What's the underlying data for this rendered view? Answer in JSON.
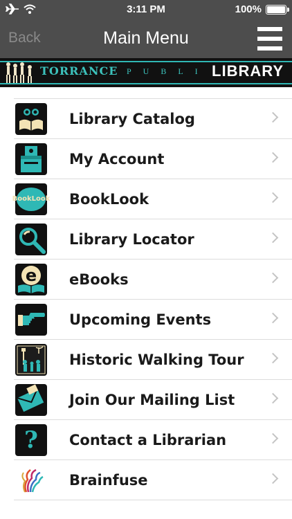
{
  "status_bar": {
    "time": "3:11 PM",
    "battery": "100%"
  },
  "nav": {
    "back_label": "Back",
    "title": "Main Menu"
  },
  "banner": {
    "name": "TORRANCE",
    "public": "PUBLIC",
    "library": "LIBRARY",
    "accent_color": "#2fb8b5"
  },
  "menu": {
    "items": [
      {
        "label": "Library Catalog",
        "icon": "catalog-icon"
      },
      {
        "label": "My Account",
        "icon": "account-icon"
      },
      {
        "label": "BookLook",
        "icon": "booklook-icon",
        "icon_text": "BookLook"
      },
      {
        "label": "Library Locator",
        "icon": "magnifier-icon"
      },
      {
        "label": "eBooks",
        "icon": "ebooks-icon",
        "icon_text": "e"
      },
      {
        "label": "Upcoming Events",
        "icon": "pointing-hand-icon"
      },
      {
        "label": "Historic Walking Tour",
        "icon": "walking-tour-icon"
      },
      {
        "label": "Join Our Mailing List",
        "icon": "envelope-icon"
      },
      {
        "label": "Contact a Librarian",
        "icon": "question-icon",
        "icon_text": "?"
      },
      {
        "label": "Brainfuse",
        "icon": "brainfuse-icon"
      }
    ]
  }
}
